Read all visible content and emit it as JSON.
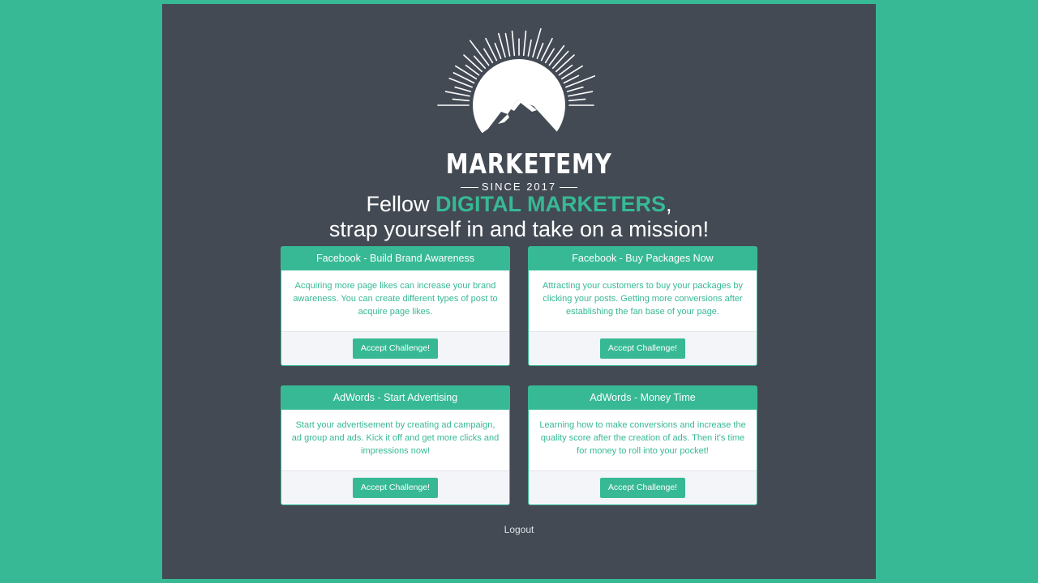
{
  "logo": {
    "word": "MARKETEMY",
    "since": "SINCE 2017"
  },
  "headline": {
    "line1_prefix": "Fellow ",
    "line1_accent": "DIGITAL MARKETERS",
    "line1_suffix": ",",
    "line2": "strap yourself in and take on a mission!"
  },
  "cards": [
    {
      "title": "Facebook - Build Brand Awareness",
      "body": "Acquiring more page likes can increase your brand awareness. You can create different types of post to acquire page likes.",
      "button": "Accept Challenge!"
    },
    {
      "title": "Facebook - Buy Packages Now",
      "body": "Attracting your customers to buy your packages by clicking your posts. Getting more conversions after establishing the fan base of your page.",
      "button": "Accept Challenge!"
    },
    {
      "title": "AdWords - Start Advertising",
      "body": "Start your advertisement by creating ad campaign, ad group and ads. Kick it off and get more clicks and impressions now!",
      "button": "Accept Challenge!"
    },
    {
      "title": "AdWords - Money Time",
      "body": "Learning how to make conversions and increase the quality score after the creation of ads. Then it's time for money to roll into your pocket!",
      "button": "Accept Challenge!"
    }
  ],
  "footer": {
    "logout": "Logout"
  },
  "colors": {
    "accent": "#37b995",
    "panel": "#434a54"
  }
}
